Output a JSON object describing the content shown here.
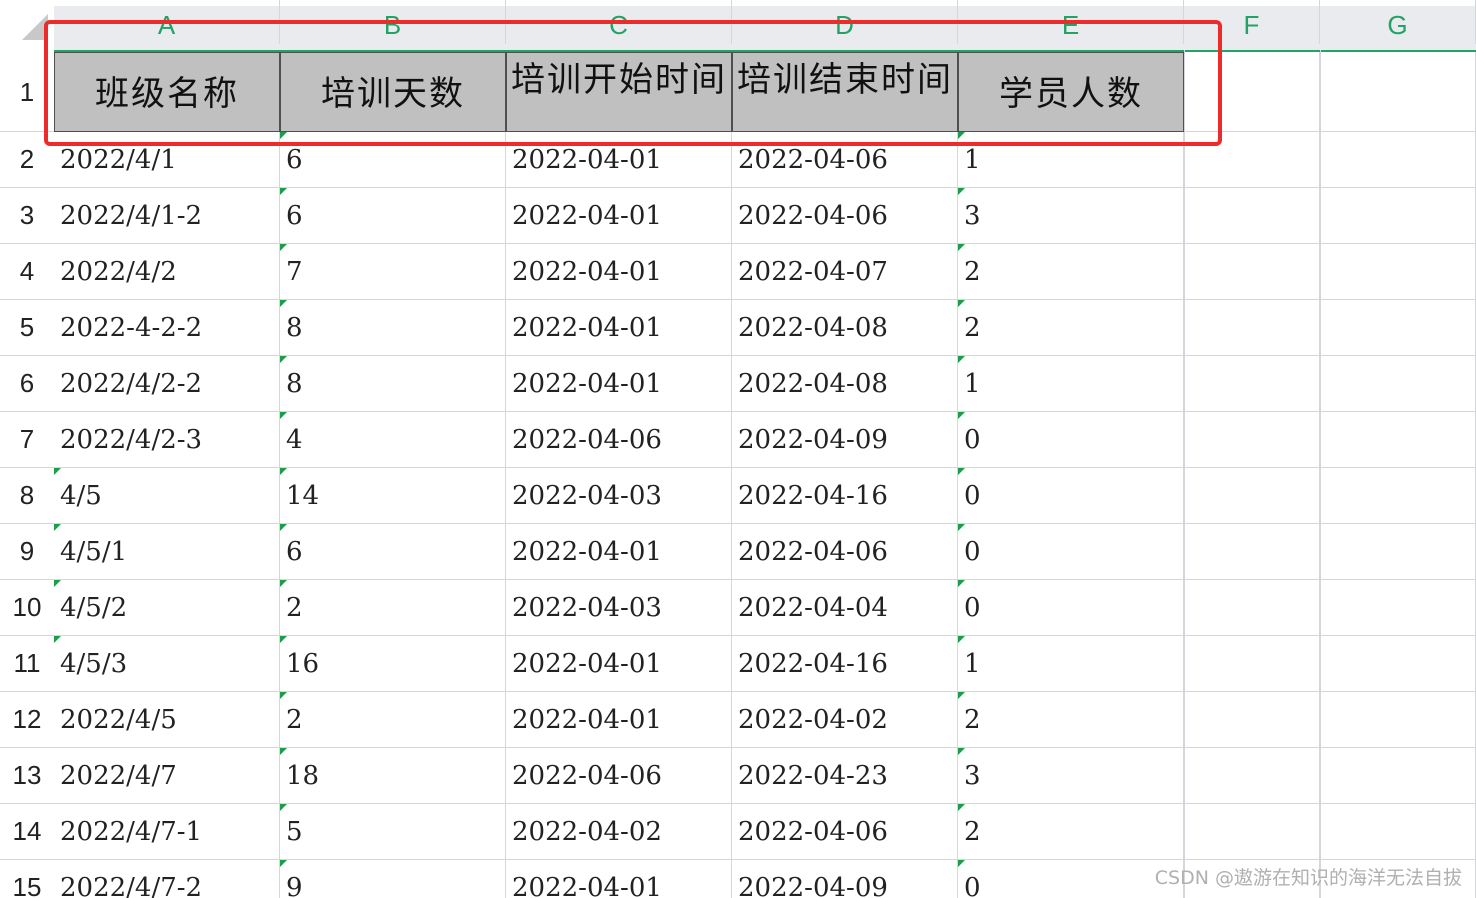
{
  "columns": [
    "A",
    "B",
    "C",
    "D",
    "E",
    "F",
    "G"
  ],
  "header_row_number": "1",
  "headers": [
    "班级名称",
    "培训天数",
    "培训开始时间",
    "培训结束时间",
    "学员人数"
  ],
  "rows": [
    {
      "num": "2",
      "cells": [
        "2022/4/1",
        "6",
        "2022-04-01",
        "2022-04-06",
        "1"
      ]
    },
    {
      "num": "3",
      "cells": [
        "2022/4/1-2",
        "6",
        "2022-04-01",
        "2022-04-06",
        "3"
      ]
    },
    {
      "num": "4",
      "cells": [
        "2022/4/2",
        "7",
        "2022-04-01",
        "2022-04-07",
        "2"
      ]
    },
    {
      "num": "5",
      "cells": [
        "2022-4-2-2",
        "8",
        "2022-04-01",
        "2022-04-08",
        "2"
      ]
    },
    {
      "num": "6",
      "cells": [
        "2022/4/2-2",
        "8",
        "2022-04-01",
        "2022-04-08",
        "1"
      ]
    },
    {
      "num": "7",
      "cells": [
        "2022/4/2-3",
        "4",
        "2022-04-06",
        "2022-04-09",
        "0"
      ]
    },
    {
      "num": "8",
      "cells": [
        "4/5",
        "14",
        "2022-04-03",
        "2022-04-16",
        "0"
      ]
    },
    {
      "num": "9",
      "cells": [
        "4/5/1",
        "6",
        "2022-04-01",
        "2022-04-06",
        "0"
      ]
    },
    {
      "num": "10",
      "cells": [
        "4/5/2",
        "2",
        "2022-04-03",
        "2022-04-04",
        "0"
      ]
    },
    {
      "num": "11",
      "cells": [
        "4/5/3",
        "16",
        "2022-04-01",
        "2022-04-16",
        "1"
      ]
    },
    {
      "num": "12",
      "cells": [
        "2022/4/5",
        "2",
        "2022-04-01",
        "2022-04-02",
        "2"
      ]
    },
    {
      "num": "13",
      "cells": [
        "2022/4/7",
        "18",
        "2022-04-06",
        "2022-04-23",
        "3"
      ]
    },
    {
      "num": "14",
      "cells": [
        "2022/4/7-1",
        "5",
        "2022-04-02",
        "2022-04-06",
        "2"
      ]
    },
    {
      "num": "15",
      "cells": [
        "2022/4/7-2",
        "9",
        "2022-04-01",
        "2022-04-09",
        "0"
      ]
    }
  ],
  "watermark": "CSDN @遨游在知识的海洋无法自拔",
  "colors": {
    "accent": "#21a366",
    "header_fill": "#c0c0c0",
    "highlight": "#ee2b2b"
  }
}
